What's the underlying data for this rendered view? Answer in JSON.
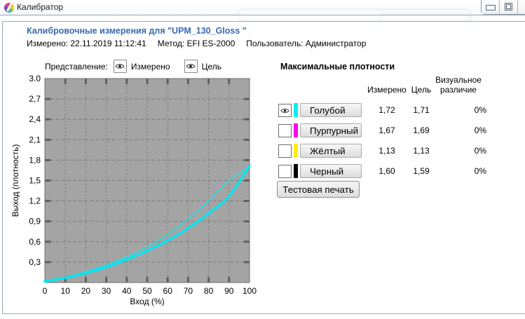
{
  "window": {
    "title": "Калибратор"
  },
  "header": {
    "title": "Калибровочные измерения для \"UPM_130_Gloss \"",
    "measured": "Измерено: 22.11.2019 11:12:41",
    "method": "Метод: EFI ES-2000",
    "user": "Пользователь: Администратор"
  },
  "view_controls": {
    "label": "Представление:",
    "measured_toggle": "Измерено",
    "target_toggle": "Цель"
  },
  "chart_data": {
    "type": "line",
    "xlabel": "Вход (%)",
    "ylabel": "Выход (плотность)",
    "xlim": [
      0,
      100
    ],
    "ylim": [
      0,
      3
    ],
    "grid": true,
    "plot_bg": "#a4a4a4",
    "grid_color": "#787878",
    "tick_color": "#5f5f5f",
    "x_ticks": [
      0,
      10,
      20,
      30,
      40,
      50,
      60,
      70,
      80,
      90,
      100
    ],
    "x_tick_labels": [
      "0",
      "10",
      "20",
      "30",
      "40",
      "50",
      "60",
      "70",
      "80",
      "90",
      "100"
    ],
    "y_ticks": [
      3.0,
      2.7,
      2.4,
      2.1,
      1.8,
      1.5,
      1.2,
      0.9,
      0.6,
      0.3
    ],
    "y_tick_labels": [
      "3.0",
      "2,7",
      "2,4",
      "2,1",
      "1,8",
      "1,5",
      "1,2",
      "0,9",
      "0,6",
      "0,3"
    ],
    "x": [
      0,
      10,
      20,
      30,
      40,
      50,
      60,
      70,
      80,
      90,
      100
    ],
    "series": [
      {
        "name": "Измерено",
        "color": "#00e6f2",
        "width": 3.4,
        "values": [
          0.02,
          0.07,
          0.14,
          0.23,
          0.34,
          0.47,
          0.62,
          0.8,
          1.02,
          1.27,
          1.72
        ]
      },
      {
        "name": "Цель",
        "color": "#12e8f2",
        "width": 1.3,
        "values": [
          0.0,
          0.08,
          0.16,
          0.26,
          0.38,
          0.53,
          0.71,
          0.94,
          1.2,
          1.5,
          1.71
        ]
      }
    ]
  },
  "densities": {
    "title": "Максимальные плотности",
    "columns": {
      "measured": "Измерено",
      "target": "Цель",
      "diff_line1": "Визуальное",
      "diff_line2": "различие"
    },
    "rows": [
      {
        "name": "Голубой",
        "color": "#00f0f0",
        "measured": "1,72",
        "target": "1,71",
        "diff": "0%",
        "visible": true
      },
      {
        "name": "Пурпурный",
        "color": "#ff00f0",
        "measured": "1,67",
        "target": "1,69",
        "diff": "0%",
        "visible": false
      },
      {
        "name": "Жёлтый",
        "color": "#fff000",
        "measured": "1,13",
        "target": "1,13",
        "diff": "0%",
        "visible": false
      },
      {
        "name": "Черный",
        "color": "#000000",
        "measured": "1,60",
        "target": "1,59",
        "diff": "0%",
        "visible": false
      }
    ],
    "test_print": "Тестовая печать"
  }
}
